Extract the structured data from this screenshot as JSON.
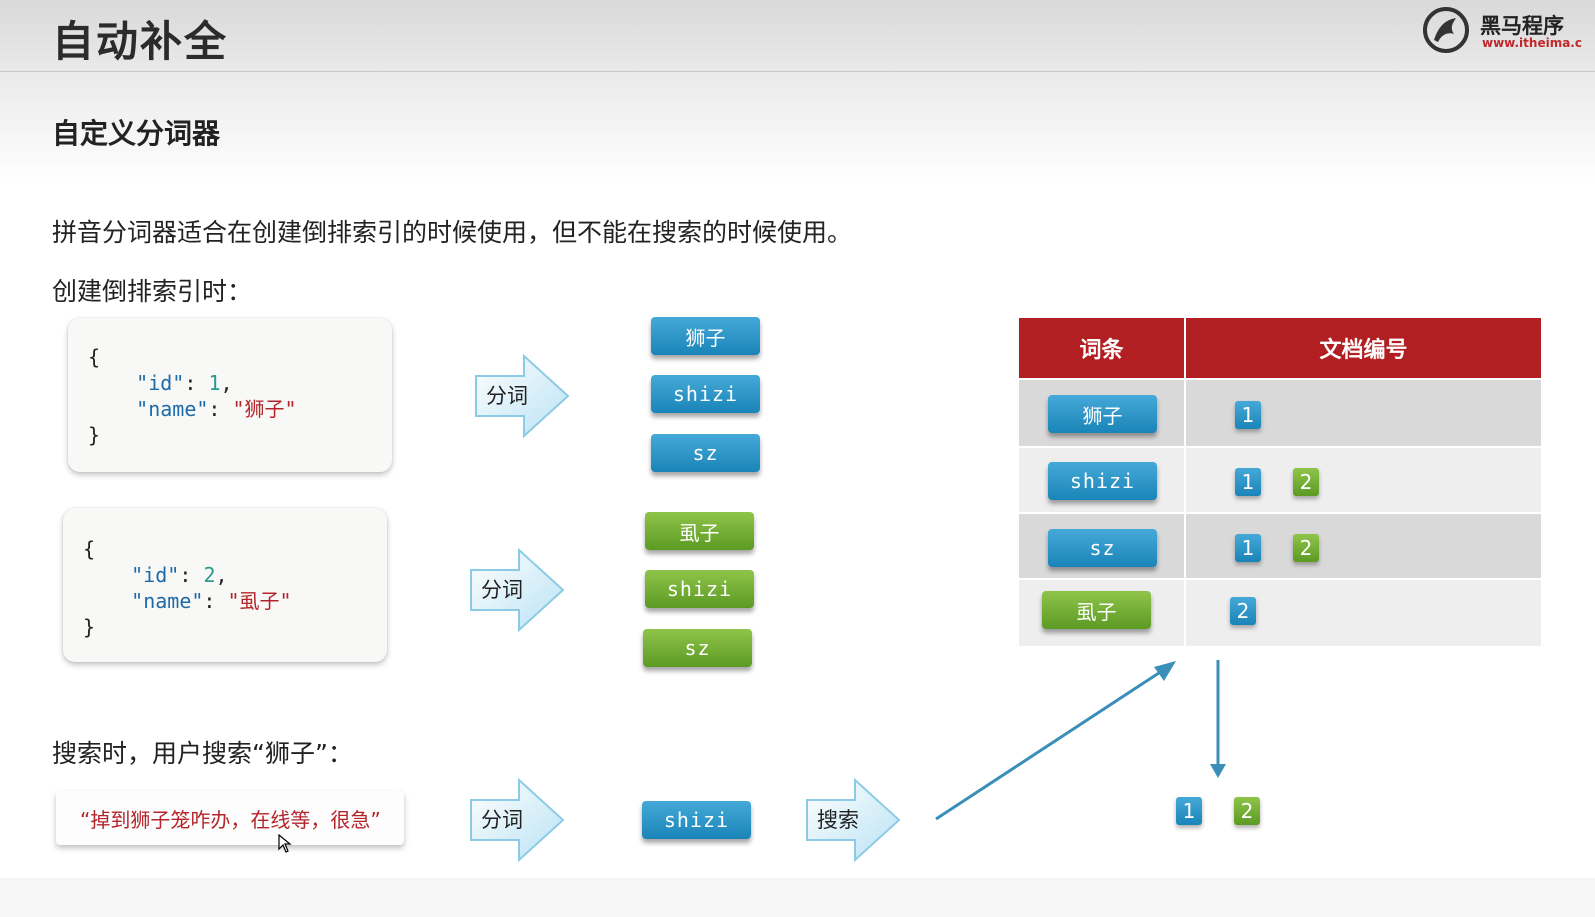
{
  "slide": {
    "title": "自动补全",
    "subtitle": "自定义分词器",
    "intro": "拼音分词器适合在创建倒排索引的时候使用，但不能在搜索的时候使用。",
    "indexing_label": "创建倒排索引时：",
    "search_label": "搜索时，用户搜索“狮子”："
  },
  "logo": {
    "name": "黑马程序",
    "url": "www.itheima.c"
  },
  "documents": [
    {
      "open": "{",
      "id_key": "\"id\"",
      "id_value": "1",
      "name_key": "\"name\"",
      "name_value": "\"狮子\"",
      "close": "}"
    },
    {
      "open": "{",
      "id_key": "\"id\"",
      "id_value": "2",
      "name_key": "\"name\"",
      "name_value": "\"虱子\"",
      "close": "}"
    }
  ],
  "arrows": {
    "tokenize": "分词",
    "search": "搜索"
  },
  "tokens_doc1": [
    "狮子",
    "shizi",
    "sz"
  ],
  "tokens_doc2": [
    "虱子",
    "shizi",
    "sz"
  ],
  "table": {
    "headers": [
      "词条",
      "文档编号"
    ],
    "rows": [
      {
        "term": "狮子",
        "term_color": "blue",
        "docs": [
          "1"
        ]
      },
      {
        "term": "shizi",
        "term_color": "blue",
        "docs": [
          "1",
          "2"
        ]
      },
      {
        "term": "sz",
        "term_color": "blue",
        "docs": [
          "1",
          "2"
        ]
      },
      {
        "term": "虱子",
        "term_color": "green",
        "docs": [
          "2"
        ]
      }
    ]
  },
  "query": {
    "text": "“掉到狮子笼咋办，在线等，很急”",
    "token": "shizi"
  },
  "results": [
    "1",
    "2"
  ],
  "colors": {
    "blue": "#1a84b8",
    "green": "#5c9a24",
    "header_red": "#b21f23",
    "string_red": "#b3252b"
  }
}
